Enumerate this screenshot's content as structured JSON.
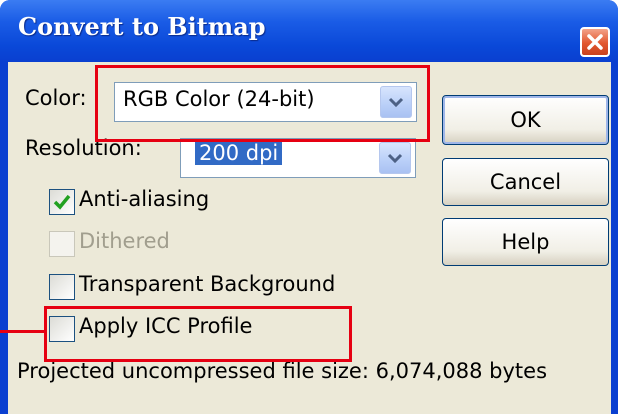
{
  "window": {
    "title": "Convert to Bitmap"
  },
  "color": {
    "label": "Color:",
    "value": "RGB Color (24-bit)"
  },
  "resolution": {
    "label": "Resolution:",
    "value": "200 dpi"
  },
  "options": {
    "anti_aliasing": {
      "label": "Anti-aliasing",
      "checked": true
    },
    "dithered": {
      "label": "Dithered",
      "checked": false,
      "enabled": false
    },
    "transparent_background": {
      "label": "Transparent Background",
      "checked": false
    },
    "apply_icc_profile": {
      "label": "Apply ICC Profile",
      "checked": false
    }
  },
  "buttons": {
    "ok": "OK",
    "cancel": "Cancel",
    "help": "Help"
  },
  "status": {
    "file_size": "Projected uncompressed file size: 6,074,088 bytes"
  },
  "colors": {
    "title_bar": "#0a48d8",
    "dialog_bg": "#ece9d8",
    "highlight_box": "#e60012",
    "selection": "#316ac5",
    "checkmark": "#21a121"
  }
}
